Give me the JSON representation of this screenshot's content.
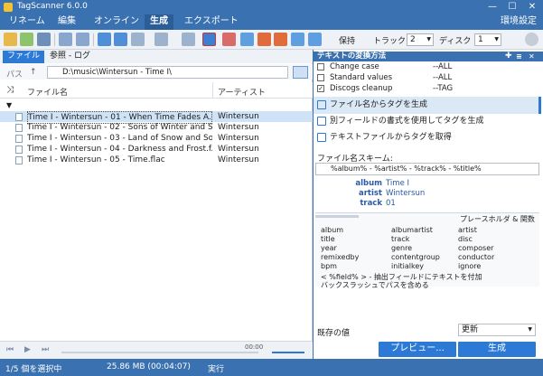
{
  "window": {
    "title": "TagScanner 6.0.0",
    "minimize": "—",
    "maximize": "☐",
    "close": "✕"
  },
  "menu": {
    "items": [
      "リネーム",
      "編集",
      "オンライン",
      "生成",
      "エクスポート"
    ],
    "settings": "環境設定"
  },
  "toolbar": {
    "save_mode": "保持",
    "track_label": "トラック",
    "track_value": "2",
    "disc_label": "ディスク",
    "disc_value": "1"
  },
  "left": {
    "tabs": [
      "ファイル",
      "参照 - ログ"
    ],
    "path_label": "パス",
    "path_value": "D:\\music\\Wintersun - Time I\\",
    "columns": {
      "filename": "ファイル名",
      "artist": "アーティスト"
    },
    "rows": [
      {
        "filename": "Time I - Wintersun - 01 - When Time Fades A...",
        "artist": "Wintersun"
      },
      {
        "filename": "Time I - Wintersun - 02 - Sons of Winter and S...",
        "artist": "Wintersun"
      },
      {
        "filename": "Time I - Wintersun - 03 - Land of Snow and So...",
        "artist": "Wintersun"
      },
      {
        "filename": "Time I - Wintersun - 04 - Darkness and Frost.f...",
        "artist": "Wintersun"
      },
      {
        "filename": "Time I - Wintersun - 05 - Time.flac",
        "artist": "Wintersun"
      }
    ],
    "player_time": "00:00"
  },
  "status": {
    "selected": "1/5 個を選択中",
    "size": "25.86 MB (00:04:07)",
    "mode": "実行"
  },
  "right": {
    "panel_title": "テキストの変換方法",
    "conversions": [
      {
        "name": "Change case",
        "target": "--ALL",
        "checked": ""
      },
      {
        "name": "Standard values",
        "target": "--ALL",
        "checked": ""
      },
      {
        "name": "Discogs cleanup",
        "target": "--TAG",
        "checked": "✓"
      }
    ],
    "actions": [
      "ファイル名からタグを生成",
      "別フィールドの書式を使用してタグを生成",
      "テキストファイルからタグを取得"
    ],
    "scheme_label": "ファイル名スキーム:",
    "scheme_value": "%album% - %artist% - %track% - %title%",
    "preview": [
      {
        "k": "album",
        "v": "Time I"
      },
      {
        "k": "artist",
        "v": "Wintersun"
      },
      {
        "k": "track",
        "v": "01"
      }
    ],
    "placeholder_title": "プレースホルダ & 関数",
    "placeholders": [
      "album",
      "albumartist",
      "artist",
      "title",
      "track",
      "disc",
      "year",
      "genre",
      "composer",
      "remixedby",
      "contentgroup",
      "conductor",
      "bpm",
      "initialkey",
      "ignore"
    ],
    "hint1": "< %field% > - 抽出フィールドにテキストを付加",
    "hint2": "バックスラッシュでパスを含める",
    "existing_label": "既存の値",
    "existing_value": "更新",
    "preview_button": "プレビュー...",
    "generate_button": "生成"
  },
  "colors": {
    "accent": "#2d7ad6",
    "titlebar": "#3a71b0"
  }
}
